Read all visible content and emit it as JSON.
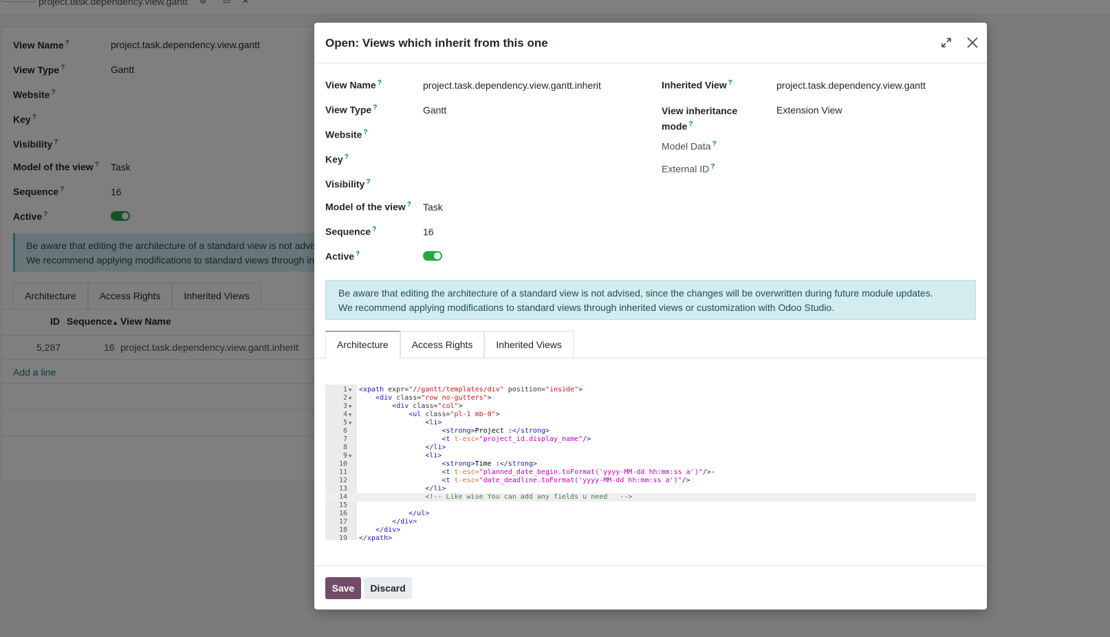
{
  "background": {
    "breadcrumb": "project.task.dependency.view.gantt",
    "fields": [
      {
        "label": "View Name",
        "value": "project.task.dependency.view.gantt"
      },
      {
        "label": "View Type",
        "value": "Gantt"
      },
      {
        "label": "Website",
        "value": ""
      },
      {
        "label": "Key",
        "value": ""
      },
      {
        "label": "Visibility",
        "value": ""
      },
      {
        "label": "Model of the view",
        "value": "Task"
      },
      {
        "label": "Sequence",
        "value": "16"
      },
      {
        "label": "Active",
        "value": ""
      }
    ],
    "alert_line1": "Be aware that editing the architecture of a standard view is not advised, since the changes will be overwritten during future module updates.",
    "alert_line2": "We recommend applying modifications to standard views through inherited views or customization with Odoo Studio.",
    "tabs": [
      "Architecture",
      "Access Rights",
      "Inherited Views"
    ],
    "active_tab": "Inherited Views",
    "table": {
      "headers": [
        "ID",
        "Sequence",
        "View Name"
      ],
      "rows": [
        {
          "id": "5,287",
          "sequence": "16",
          "view_name": "project.task.dependency.view.gantt.inherit"
        }
      ]
    },
    "add_line": "Add a line"
  },
  "modal": {
    "title": "Open: Views which inherit from this one",
    "left_fields": {
      "view_name": {
        "label": "View Name",
        "value": "project.task.dependency.view.gantt.inherit"
      },
      "view_type": {
        "label": "View Type",
        "value": "Gantt"
      },
      "website": {
        "label": "Website",
        "value": ""
      },
      "key": {
        "label": "Key",
        "value": ""
      },
      "visibility": {
        "label": "Visibility",
        "value": ""
      },
      "model": {
        "label": "Model of the view",
        "value": "Task"
      },
      "sequence": {
        "label": "Sequence",
        "value": "16"
      },
      "active": {
        "label": "Active",
        "value": true
      }
    },
    "right_fields": {
      "inherited_view": {
        "label": "Inherited View",
        "value": "project.task.dependency.view.gantt"
      },
      "inheritance_mode": {
        "label_line1": "View inheritance",
        "label_line2": "mode",
        "value": "Extension View"
      },
      "model_data": {
        "label": "Model Data",
        "value": ""
      },
      "external_id": {
        "label": "External ID",
        "value": ""
      }
    },
    "alert_line1": "Be aware that editing the architecture of a standard view is not advised, since the changes will be overwritten during future module updates.",
    "alert_line2": "We recommend applying modifications to standard views through inherited views or customization with Odoo Studio.",
    "tabs": [
      "Architecture",
      "Access Rights",
      "Inherited Views"
    ],
    "active_tab": "Architecture",
    "code_lines": [
      "<xpath expr=\"//gantt/templates/div\" position=\"inside\">",
      "    <div class=\"row no-gutters\">",
      "        <div class=\"col\">",
      "            <ul class=\"pl-1 mb-0\">",
      "                <li>",
      "                    <strong>Project :</strong>",
      "                    <t t-esc=\"project_id.display_name\"/>",
      "                </li>",
      "                <li>",
      "                    <strong>Time :</strong>",
      "                    <t t-esc=\"planned_date_begin.toFormat('yyyy-MM-dd hh:mm:ss a')\"/>-",
      "                    <t t-esc=\"date_deadline.toFormat('yyyy-MM-dd hh:mm:ss a')\"/>",
      "                </li>",
      "                <!-- Like wise You can add any fields u need   -->",
      "",
      "            </ul>",
      "        </div>",
      "    </div>",
      "</xpath>"
    ],
    "save_label": "Save",
    "discard_label": "Discard"
  },
  "colors": {
    "primary": "#714b67",
    "alert_bg": "#d2ecef",
    "toggle_on": "#28a745",
    "help": "#017e84"
  }
}
